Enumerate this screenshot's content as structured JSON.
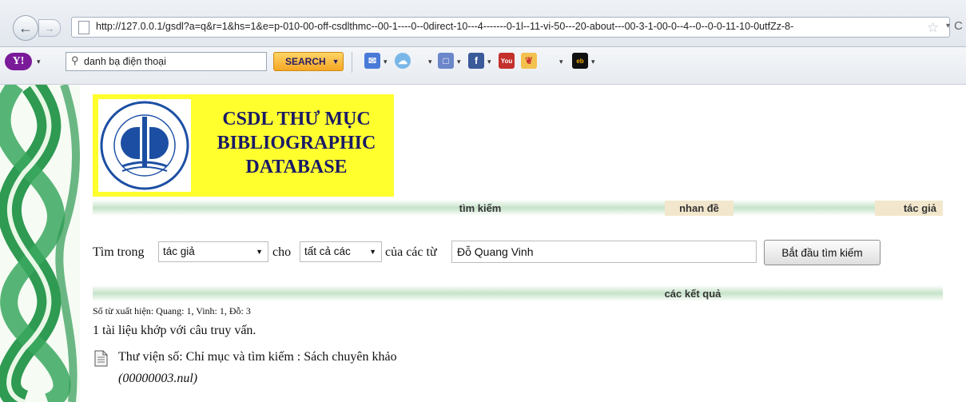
{
  "browser": {
    "url": "http://127.0.0.1/gsdl?a=q&r=1&hs=1&e=p-010-00-off-csdlthmc--00-1----0--0direct-10---4-------0-1l--11-vi-50---20-about---00-3-1-00-0--4--0--0-0-11-10-0utfZz-8-"
  },
  "toolbar": {
    "search_value": "danh bạ điện thoại",
    "search_button": "SEARCH",
    "logo": "Y!"
  },
  "header": {
    "title_line1": "CSDL THƯ MỤC",
    "title_line2": "BIBLIOGRAPHIC",
    "title_line3": "DATABASE",
    "seal_text": "TRƯỜNG ĐẠI HỌC NỘI VỤ HÀ NỘI"
  },
  "nav": {
    "search": "tìm kiếm",
    "title": "nhan đề",
    "author": "tác giả"
  },
  "form": {
    "label_search_in": "Tìm trong",
    "field_select": "tác giả",
    "label_for": "cho",
    "scope_select": "tất cả các",
    "label_of_words": "của các từ",
    "query": "Đỗ Quang Vinh",
    "submit": "Bắt đầu tìm kiếm"
  },
  "results": {
    "header": "các kết quả",
    "word_counts": "Số từ xuất hiện: Quang: 1, Vinh: 1, Đỗ: 3",
    "match_summary": "1 tài liệu khớp với câu truy vấn.",
    "items": [
      {
        "title": "Thư viện số: Chỉ mục và tìm kiếm : Sách chuyên khảo",
        "file": "(00000003.nul)"
      }
    ]
  },
  "colors": {
    "header_yellow": "#ffff2e",
    "nav_green": "#c6e3c9",
    "nav_tab_tan": "#f2e7cc",
    "title_blue": "#1a1a66",
    "band_green": "#2f9a52"
  }
}
